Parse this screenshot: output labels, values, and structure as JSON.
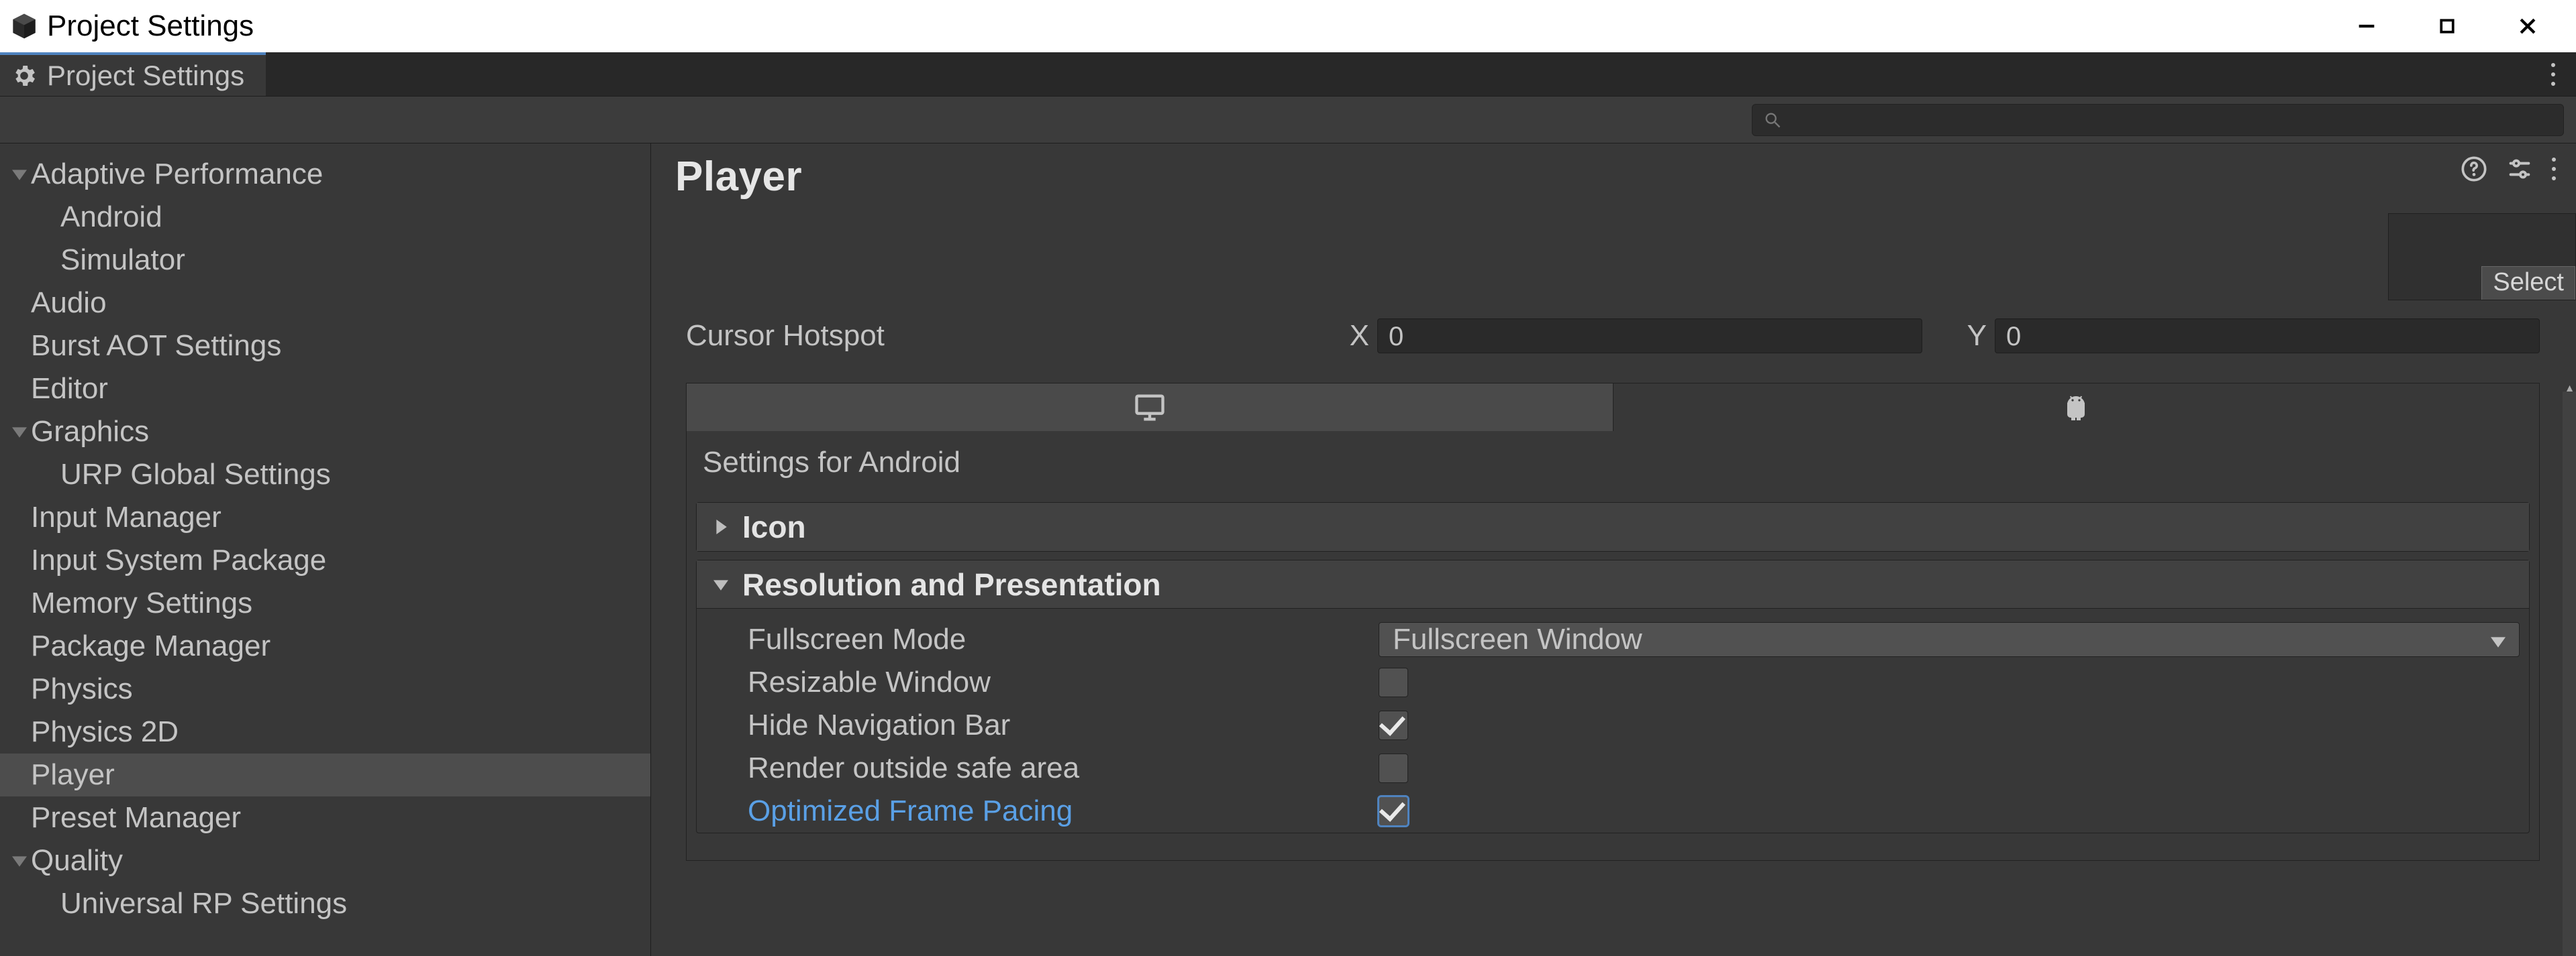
{
  "window": {
    "title": "Project Settings"
  },
  "tab": {
    "label": "Project Settings"
  },
  "search": {
    "placeholder": ""
  },
  "sidebar": {
    "items": [
      {
        "label": "Adaptive Performance",
        "depth": 0,
        "caret": "down"
      },
      {
        "label": "Android",
        "depth": 1
      },
      {
        "label": "Simulator",
        "depth": 1
      },
      {
        "label": "Audio",
        "depth": 0
      },
      {
        "label": "Burst AOT Settings",
        "depth": 0
      },
      {
        "label": "Editor",
        "depth": 0
      },
      {
        "label": "Graphics",
        "depth": 0,
        "caret": "down"
      },
      {
        "label": "URP Global Settings",
        "depth": 1
      },
      {
        "label": "Input Manager",
        "depth": 0
      },
      {
        "label": "Input System Package",
        "depth": 0
      },
      {
        "label": "Memory Settings",
        "depth": 0
      },
      {
        "label": "Package Manager",
        "depth": 0
      },
      {
        "label": "Physics",
        "depth": 0
      },
      {
        "label": "Physics 2D",
        "depth": 0
      },
      {
        "label": "Player",
        "depth": 0,
        "selected": true
      },
      {
        "label": "Preset Manager",
        "depth": 0
      },
      {
        "label": "Quality",
        "depth": 0,
        "caret": "down"
      },
      {
        "label": "Universal RP Settings",
        "depth": 1
      }
    ]
  },
  "page": {
    "title": "Player",
    "select_button": "Select",
    "cursor_hotspot": {
      "label": "Cursor Hotspot",
      "x_label": "X",
      "x_value": "0",
      "y_label": "Y",
      "y_value": "0"
    },
    "platform_subtitle": "Settings for Android",
    "panels": {
      "icon": {
        "title": "Icon",
        "expanded": false
      },
      "resolution": {
        "title": "Resolution and Presentation",
        "expanded": true,
        "rows": {
          "fullscreen_mode": {
            "label": "Fullscreen Mode",
            "value": "Fullscreen Window"
          },
          "resizable_window": {
            "label": "Resizable Window",
            "checked": false
          },
          "hide_nav_bar": {
            "label": "Hide Navigation Bar",
            "checked": true
          },
          "render_outside_safe": {
            "label": "Render outside safe area",
            "checked": false
          },
          "optimized_frame_pacing": {
            "label": "Optimized Frame Pacing",
            "checked": true,
            "highlight": true
          }
        }
      }
    }
  }
}
